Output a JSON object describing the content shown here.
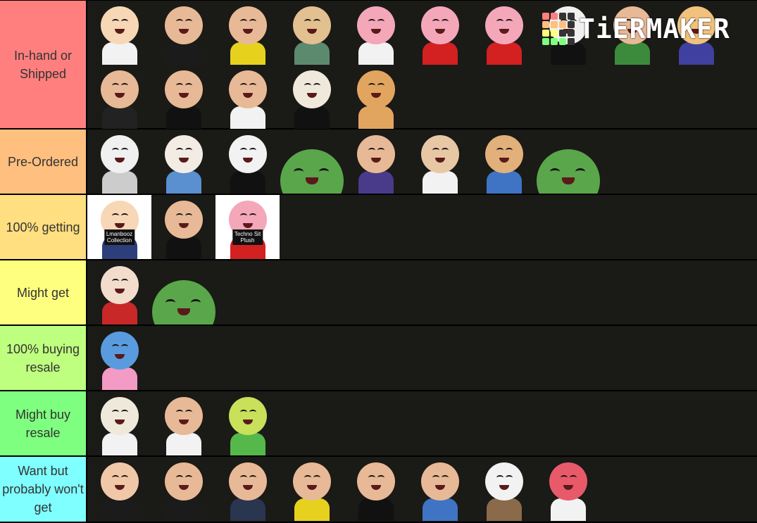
{
  "logo": {
    "text": "TiERMAKER",
    "grid_colors": [
      "#ff7f7f",
      "#ff7f7f",
      "#333333",
      "#333333",
      "#ffbf7f",
      "#ffbf7f",
      "#ffbf7f",
      "#333333",
      "#ffff7f",
      "#ffff7f",
      "#333333",
      "#333333",
      "#7fff7f",
      "#7fff7f",
      "#7fff7f",
      "#333333"
    ]
  },
  "tiers": [
    {
      "label": "In-hand or Shipped",
      "color": "#ff7f7f",
      "rows": 2,
      "items": [
        {
          "name": "blonde-character-with-camera",
          "skin": "#f7d7b5",
          "body": "#f2f2f2",
          "bg": ""
        },
        {
          "name": "character-with-guitar-black-outfit",
          "skin": "#e8b996",
          "body": "#1b1b1b",
          "bg": ""
        },
        {
          "name": "character-yellow-shirt-guitar",
          "skin": "#e8b996",
          "body": "#e6d21e",
          "bg": ""
        },
        {
          "name": "bearded-character-with-heart",
          "skin": "#e2c090",
          "body": "#5b8a6e",
          "bg": ""
        },
        {
          "name": "pig-character-white-coat",
          "skin": "#f4a7b9",
          "body": "#f2f2f2",
          "bg": ""
        },
        {
          "name": "pig-king-on-plane",
          "skin": "#f4a7b9",
          "body": "#d32020",
          "bg": ""
        },
        {
          "name": "pig-king-standing",
          "skin": "#f4a7b9",
          "body": "#d32020",
          "bg": ""
        },
        {
          "name": "masked-character-suit",
          "skin": "#f0f0f0",
          "body": "#111111",
          "bg": ""
        },
        {
          "name": "character-with-bee-boat",
          "skin": "#e8b996",
          "body": "#3c8a3c",
          "bg": ""
        },
        {
          "name": "character-with-noodle-bowl",
          "skin": "#f1c27d",
          "body": "#4040a0",
          "bg": ""
        },
        {
          "name": "hourglass-character",
          "skin": "#e8b996",
          "body": "#222222",
          "bg": ""
        },
        {
          "name": "character-black-outfit",
          "skin": "#e8b996",
          "body": "#111111",
          "bg": ""
        },
        {
          "name": "character-white-suit",
          "skin": "#e8b996",
          "body": "#f2f2f2",
          "bg": ""
        },
        {
          "name": "goat-character-suit",
          "skin": "#efe9dc",
          "body": "#111111",
          "bg": ""
        },
        {
          "name": "shiba-dog-pink-hat",
          "skin": "#e2a560",
          "body": "#e2a560",
          "bg": ""
        }
      ]
    },
    {
      "label": "Pre-Ordered",
      "color": "#ffbf7f",
      "rows": 1,
      "items": [
        {
          "name": "masked-grey-character",
          "skin": "#f0f0f0",
          "body": "#cccccc",
          "bg": ""
        },
        {
          "name": "ram-character-blue-sweater",
          "skin": "#f2ece4",
          "body": "#5a8fd0",
          "bg": ""
        },
        {
          "name": "black-white-goat-red-tie",
          "skin": "#f2f2f2",
          "body": "#111111",
          "bg": ""
        },
        {
          "name": "green-blob-smiling",
          "skin": "#5aa64a",
          "body": "#5aa64a",
          "bg": "",
          "blob": true
        },
        {
          "name": "character-headphones-bench",
          "skin": "#e8b996",
          "body": "#4a3a8a",
          "bg": ""
        },
        {
          "name": "character-white-hoodie-bee",
          "skin": "#e8c7a5",
          "body": "#f2f2f2",
          "bg": ""
        },
        {
          "name": "character-red-sunglasses",
          "skin": "#e2b07a",
          "body": "#3f74c4",
          "bg": ""
        },
        {
          "name": "green-blob-with-stick",
          "skin": "#5aa64a",
          "body": "#5aa64a",
          "bg": "",
          "blob": true
        }
      ]
    },
    {
      "label": "100% getting",
      "color": "#ffdf7f",
      "rows": 1,
      "items": [
        {
          "name": "lmanberg-collection",
          "skin": "#f7d7b5",
          "body": "#2c3f7a",
          "bg": "#ffffff",
          "caption": "Lmanbooz\nCollection"
        },
        {
          "name": "character-with-pugs",
          "skin": "#e8b996",
          "body": "#111111",
          "bg": ""
        },
        {
          "name": "techno-sit-plush",
          "skin": "#f4a7b9",
          "body": "#d32020",
          "bg": "#ffffff",
          "caption": "Techno Sit\nPlush"
        }
      ]
    },
    {
      "label": "Might get",
      "color": "#ffff7f",
      "rows": 1,
      "items": [
        {
          "name": "purple-hair-sunglasses-character",
          "skin": "#f2dccc",
          "body": "#c82828",
          "bg": ""
        },
        {
          "name": "green-blob-open-mouth",
          "skin": "#5aa64a",
          "body": "#5aa64a",
          "bg": "",
          "blob": true
        }
      ]
    },
    {
      "label": "100% buying resale",
      "color": "#bfff7f",
      "rows": 1,
      "items": [
        {
          "name": "blue-skin-blonde-character",
          "skin": "#5a9be0",
          "body": "#f39ac5",
          "bg": ""
        }
      ]
    },
    {
      "label": "Might buy resale",
      "color": "#7fff7f",
      "rows": 1,
      "items": [
        {
          "name": "goat-character-armchair",
          "skin": "#efe9dc",
          "body": "#f2f2f2",
          "bg": ""
        },
        {
          "name": "character-bowtie-white-shirt",
          "skin": "#e8b996",
          "body": "#f2f2f2",
          "bg": ""
        },
        {
          "name": "green-plant-character",
          "skin": "#c8e05a",
          "body": "#56b84a",
          "bg": ""
        }
      ]
    },
    {
      "label": "Want but probably won't get",
      "color": "#7fffff",
      "rows": 1,
      "items": [
        {
          "name": "bearded-character-teddy-bear",
          "skin": "#f0c8a8",
          "body": "#1b1b1b",
          "bg": ""
        },
        {
          "name": "character-headphones-guitar",
          "skin": "#e8b996",
          "body": "#1b1b1b",
          "bg": ""
        },
        {
          "name": "character-dabbing",
          "skin": "#e8b996",
          "body": "#2a3550",
          "bg": ""
        },
        {
          "name": "frog-burger-character-bat",
          "skin": "#e8b996",
          "body": "#e6d21e",
          "bg": ""
        },
        {
          "name": "character-thumbs-up",
          "skin": "#e8b996",
          "body": "#111111",
          "bg": ""
        },
        {
          "name": "grey-beard-character-blue-cardigan",
          "skin": "#e8b996",
          "body": "#3f74c4",
          "bg": ""
        },
        {
          "name": "dog-character-pink-items",
          "skin": "#f2f2f2",
          "body": "#8a6a4a",
          "bg": ""
        },
        {
          "name": "red-knuckles-character-burger",
          "skin": "#e85a6a",
          "body": "#f2f2f2",
          "bg": ""
        }
      ]
    }
  ]
}
